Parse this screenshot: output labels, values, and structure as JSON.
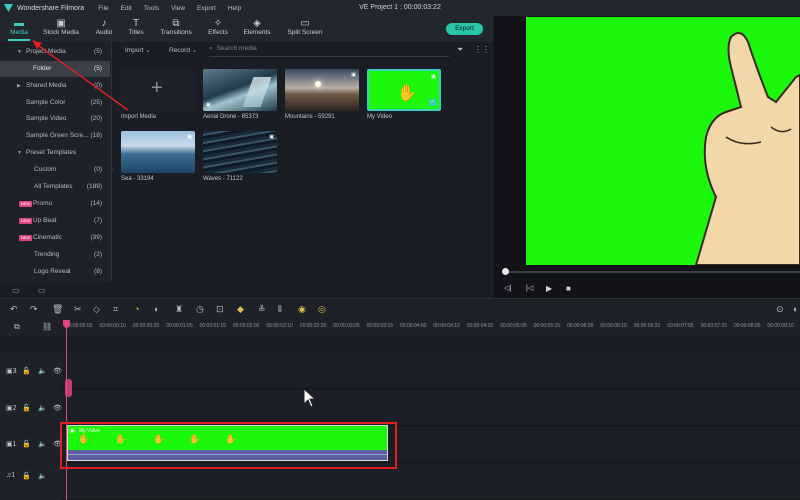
{
  "menubar": {
    "app_name": "Wondershare Filmora",
    "menu_items": [
      "File",
      "Edit",
      "Tools",
      "View",
      "Export",
      "Help"
    ],
    "project_title": "VE Project 1 : 00:00:03:22"
  },
  "tabs": [
    {
      "label": "Media",
      "icon": "folder-icon"
    },
    {
      "label": "Stock Media",
      "icon": "stock-icon"
    },
    {
      "label": "Audio",
      "icon": "music-icon"
    },
    {
      "label": "Titles",
      "icon": "text-icon"
    },
    {
      "label": "Transitions",
      "icon": "transition-icon"
    },
    {
      "label": "Effects",
      "icon": "effects-icon"
    },
    {
      "label": "Elements",
      "icon": "elements-icon"
    },
    {
      "label": "Split Screen",
      "icon": "split-screen-icon"
    }
  ],
  "export_label": "Export",
  "sidebar": {
    "items": [
      {
        "label": "Project Media",
        "count": "(5)"
      },
      {
        "label": "Folder",
        "count": "(5)"
      },
      {
        "label": "Shared Media",
        "count": "(0)"
      },
      {
        "label": "Sample Color",
        "count": "(25)"
      },
      {
        "label": "Sample Video",
        "count": "(20)"
      },
      {
        "label": "Sample Green Scre...",
        "count": "(18)"
      },
      {
        "label": "Preset Templates",
        "count": ""
      },
      {
        "label": "Custom",
        "count": "(0)"
      },
      {
        "label": "All Templates",
        "count": "(189)"
      },
      {
        "label": "Promo",
        "count": "(14)"
      },
      {
        "label": "Up Beat",
        "count": "(7)"
      },
      {
        "label": "Cinematic",
        "count": "(39)"
      },
      {
        "label": "Trending",
        "count": "(2)"
      },
      {
        "label": "Logo Reveal",
        "count": "(8)"
      }
    ],
    "badge": "NEW"
  },
  "media_toolbar": {
    "import_label": "Import",
    "record_label": "Record",
    "search_placeholder": "Search media"
  },
  "media_items": [
    {
      "label": "Import Media"
    },
    {
      "label": "Aerial Drone - 85373"
    },
    {
      "label": "Mountains - 59291"
    },
    {
      "label": "My Video"
    },
    {
      "label": "Sea - 33194"
    },
    {
      "label": "Waves - 71122"
    }
  ],
  "ruler": {
    "ticks": [
      "00:00:00:00",
      "00:00:00:10",
      "00:00:00:20",
      "00:00:01:05",
      "00:00:01:15",
      "00:00:02:00",
      "00:00:02:10",
      "00:00:02:20",
      "00:00:03:05",
      "00:00:03:15",
      "00:00:04:00",
      "00:00:04:10",
      "00:00:04:20",
      "00:00:05:05",
      "00:00:05:15",
      "00:00:06:00",
      "00:00:06:10",
      "00:00:06:20",
      "00:00:07:05",
      "00:00:07:15",
      "00:00:08:00",
      "00:00:08:10"
    ]
  },
  "tracks": [
    {
      "num": "3"
    },
    {
      "num": "2"
    },
    {
      "num": "1"
    },
    {
      "num": "1"
    }
  ],
  "clip": {
    "label": "My Video"
  },
  "colors": {
    "accent": "#3ad0c0",
    "green_screen": "#1bf80c",
    "playhead": "#e0447a",
    "annotation": "#e02020"
  }
}
